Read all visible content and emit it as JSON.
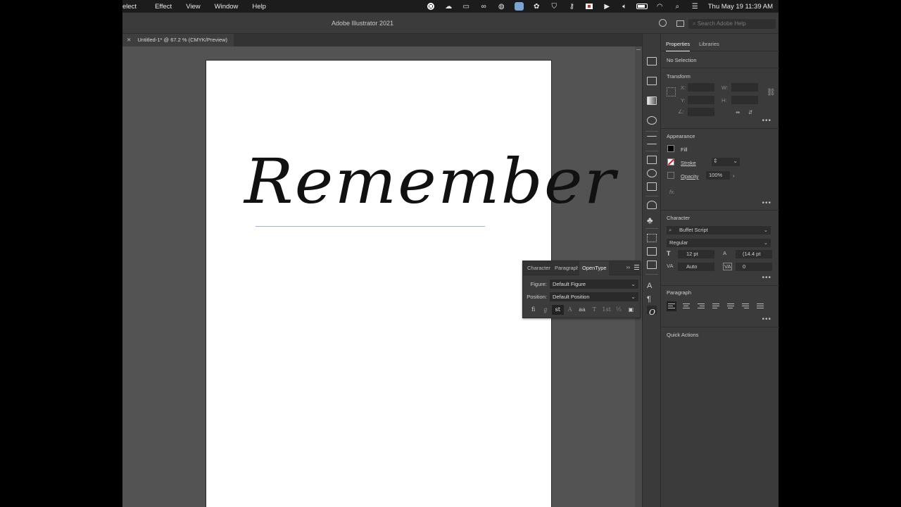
{
  "menubar": {
    "menus": [
      "elect",
      "Effect",
      "View",
      "Window",
      "Help"
    ],
    "status_icons": [
      "record-icon",
      "cloud-icon",
      "screen-icon",
      "creative-cloud-icon",
      "globe-icon",
      "telegram-icon",
      "shield-settings-icon",
      "vpn-shield-icon",
      "key-icon",
      "flag-icon",
      "play-icon",
      "volume-icon",
      "battery-icon",
      "wifi-icon",
      "search-icon",
      "control-center-icon"
    ],
    "clock": "Thu May 19  11:39 AM"
  },
  "app": {
    "title": "Adobe Illustrator 2021",
    "help_search_placeholder": "Search Adobe Help"
  },
  "document": {
    "tab_label": "Untitled-1* @ 67.2 % (CMYK/Preview)",
    "artboard_text": "Remember"
  },
  "opentype_panel": {
    "tabs": [
      "Character",
      "Paragraph",
      "OpenType"
    ],
    "active_tab": "OpenType",
    "figure_label": "Figure:",
    "figure_value": "Default Figure",
    "position_label": "Position:",
    "position_value": "Default Position",
    "glyph_buttons": [
      "ﬁ",
      "ℊ",
      "st",
      "A",
      "aa",
      "T",
      "1st",
      "½",
      "▣"
    ]
  },
  "properties": {
    "tabs": [
      "Properties",
      "Libraries"
    ],
    "selection": "No Selection",
    "transform": {
      "title": "Transform",
      "x_label": "X:",
      "y_label": "Y:",
      "w_label": "W:",
      "h_label": "H:",
      "angle_label": "∠:"
    },
    "appearance": {
      "title": "Appearance",
      "fill_label": "Fill",
      "stroke_label": "Stroke",
      "opacity_label": "Opacity",
      "opacity_value": "100%",
      "fx_label": "fx."
    },
    "character": {
      "title": "Character",
      "font_family": "Buffet Script",
      "font_style": "Regular",
      "font_size": "12 pt",
      "leading": "(14.4 pt",
      "kerning": "Auto",
      "tracking": "0"
    },
    "paragraph": {
      "title": "Paragraph"
    },
    "quick_actions": {
      "title": "Quick Actions"
    }
  },
  "colors": {
    "canvas_bg": "#535353",
    "panel_bg": "#3b3b3b",
    "stroke_red": "#d2232a"
  }
}
